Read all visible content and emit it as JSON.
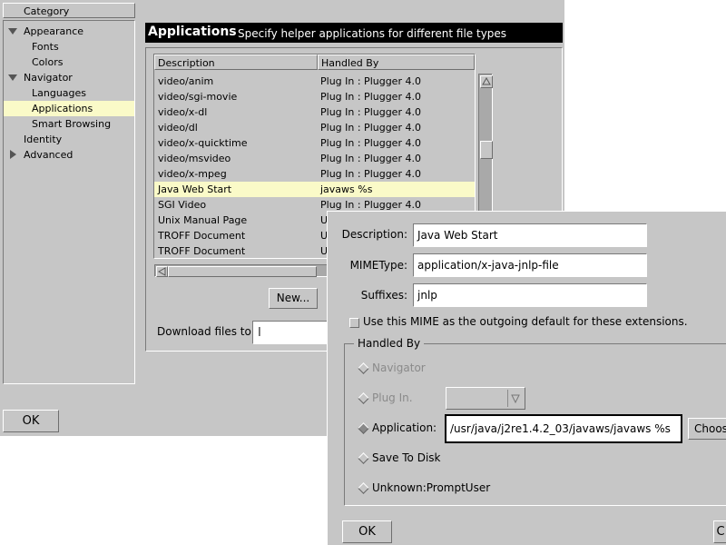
{
  "category_panel": {
    "header": "Category",
    "items": [
      {
        "label": "Appearance",
        "expander": "down"
      },
      {
        "label": "Fonts"
      },
      {
        "label": "Colors"
      },
      {
        "label": "Navigator",
        "expander": "down"
      },
      {
        "label": "Languages"
      },
      {
        "label": "Applications",
        "selected": true
      },
      {
        "label": "Smart Browsing"
      },
      {
        "label": "Identity"
      },
      {
        "label": "Advanced",
        "expander": "right"
      }
    ]
  },
  "banner": {
    "title": "Applications",
    "subtitle": "Specify helper applications for different file types"
  },
  "app_table": {
    "columns": [
      "Description",
      "Handled By"
    ],
    "rows": [
      {
        "description": "video/anim",
        "handled_by": "Plug In : Plugger 4.0"
      },
      {
        "description": "video/sgi-movie",
        "handled_by": "Plug In : Plugger 4.0"
      },
      {
        "description": "video/x-dl",
        "handled_by": "Plug In : Plugger 4.0"
      },
      {
        "description": "video/dl",
        "handled_by": "Plug In : Plugger 4.0"
      },
      {
        "description": "video/x-quicktime",
        "handled_by": "Plug In : Plugger 4.0"
      },
      {
        "description": "video/msvideo",
        "handled_by": "Plug In : Plugger 4.0"
      },
      {
        "description": "video/x-mpeg",
        "handled_by": "Plug In : Plugger 4.0"
      },
      {
        "description": "Java Web Start",
        "handled_by": "javaws %s",
        "selected": true
      },
      {
        "description": "SGI Video",
        "handled_by": "Plug In : Plugger 4.0"
      },
      {
        "description": "Unix Manual Page",
        "handled_by": "U"
      },
      {
        "description": "TROFF Document",
        "handled_by": "U"
      },
      {
        "description": "TROFF Document",
        "handled_by": "U"
      }
    ]
  },
  "buttons": {
    "new": "New...",
    "ok_main": "OK",
    "ok_dialog": "OK",
    "cancel_partial": "C",
    "choose": "Choos"
  },
  "download": {
    "label": "Download files to:",
    "value": ""
  },
  "dialog": {
    "description_label": "Description:",
    "description_value": "Java Web Start",
    "mimetype_label": "MIMEType:",
    "mimetype_value": "application/x-java-jnlp-file",
    "suffixes_label": "Suffixes:",
    "suffixes_value": "jnlp",
    "default_checkbox": "Use this MIME as the outgoing default for these extensions.",
    "handled_by_title": "Handled By",
    "options": {
      "navigator": "Navigator",
      "plugin": "Plug In.",
      "application": "Application:",
      "save_to_disk": "Save To Disk",
      "unknown": "Unknown:PromptUser"
    },
    "application_value": "/usr/java/j2re1.4.2_03/javaws/javaws %s",
    "plugin_value": ""
  },
  "colors": {
    "window_bg": "#c6c6c6",
    "selection": "#fafac8",
    "banner_bg": "#000000"
  }
}
